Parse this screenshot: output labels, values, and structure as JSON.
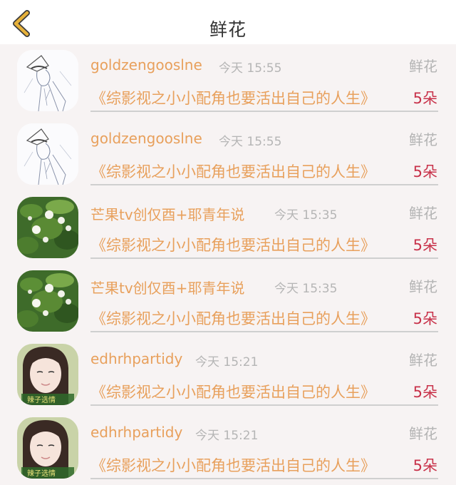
{
  "header": {
    "title": "鲜花",
    "back_icon": "chevron-left-icon",
    "back_color": "#e6b13a"
  },
  "records": [
    {
      "avatar": "sketch-avatar",
      "user": "goldzengooslne",
      "time": "今天 15:55",
      "type": "鲜花",
      "book": "《综影视之小小配角也要活出自己的人生》",
      "count": "5朵"
    },
    {
      "avatar": "sketch-avatar",
      "user": "goldzengooslne",
      "time": "今天 15:55",
      "type": "鲜花",
      "book": "《综影视之小小配角也要活出自己的人生》",
      "count": "5朵"
    },
    {
      "avatar": "flower-avatar",
      "user": "芒果tv创仅酉+耶青年说",
      "time": "今天 15:35",
      "type": "鲜花",
      "book": "《综影视之小小配角也要活出自己的人生》",
      "count": "5朵"
    },
    {
      "avatar": "flower-avatar",
      "user": "芒果tv创仅酉+耶青年说",
      "time": "今天 15:35",
      "type": "鲜花",
      "book": "《综影视之小小配角也要活出自己的人生》",
      "count": "5朵"
    },
    {
      "avatar": "girl-avatar",
      "user": "edhrhpartidy",
      "time": "今天 15:21",
      "type": "鲜花",
      "book": "《综影视之小小配角也要活出自己的人生》",
      "count": "5朵"
    },
    {
      "avatar": "girl-avatar",
      "user": "edhrhpartidy",
      "time": "今天 15:21",
      "type": "鲜花",
      "book": "《综影视之小小配角也要活出自己的人生》",
      "count": "5朵"
    }
  ],
  "colors": {
    "username": "#e8a05c",
    "count": "#c8324a",
    "muted": "#b3b3b3"
  }
}
